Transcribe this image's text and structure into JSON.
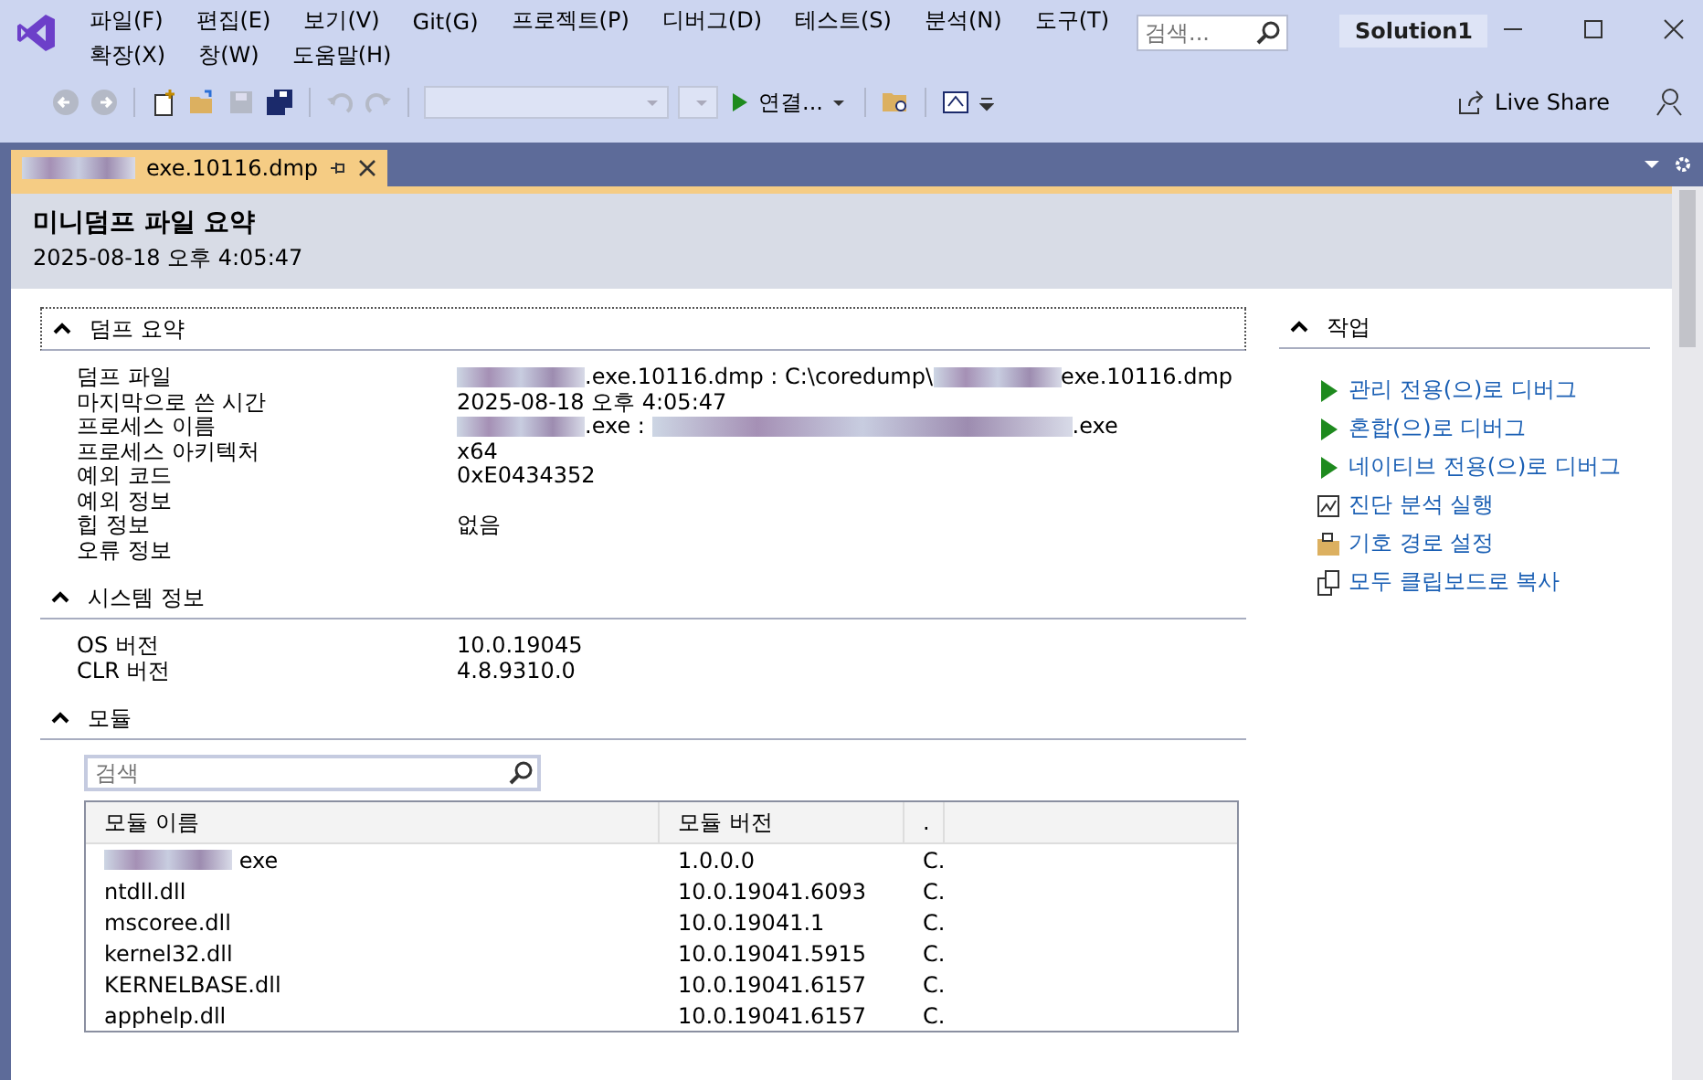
{
  "menu": {
    "rows": [
      [
        "파일(F)",
        "편집(E)",
        "보기(V)",
        "Git(G)",
        "프로젝트(P)",
        "디버그(D)",
        "테스트(S)",
        "분석(N)",
        "도구(T)"
      ],
      [
        "확장(X)",
        "창(W)",
        "도움말(H)"
      ]
    ],
    "search": {
      "placeholder": "검색..."
    },
    "solution": "Solution1"
  },
  "toolbar": {
    "attach": "연결...",
    "live_share": "Live Share"
  },
  "tab": {
    "label": "exe.10116.dmp",
    "selected": true
  },
  "header": {
    "title": "미니덤프 파일 요약",
    "time": "2025-08-18 오후 4:05:47"
  },
  "sections": [
    {
      "title": "덤프 요약",
      "expanded": true,
      "focused": true,
      "rows": [
        {
          "label": "덤프 파일",
          "value": [
            {
              "kind": "redacted"
            },
            {
              "kind": "text",
              "text": ".exe.10116.dmp : C:\\coredump\\"
            },
            {
              "kind": "redacted"
            },
            {
              "kind": "text",
              "text": "exe.10116.dmp"
            }
          ]
        },
        {
          "label": "마지막으로 쓴 시간",
          "value": [
            {
              "kind": "text",
              "text": "2025-08-18 오후 4:05:47"
            }
          ]
        },
        {
          "label": "프로세스 이름",
          "value": [
            {
              "kind": "redacted"
            },
            {
              "kind": "text",
              "text": ".exe : "
            },
            {
              "kind": "redacted_long"
            },
            {
              "kind": "text",
              "text": ".exe"
            }
          ]
        },
        {
          "label": "프로세스 아키텍처",
          "value": [
            {
              "kind": "text",
              "text": "x64"
            }
          ]
        },
        {
          "label": "예외 코드",
          "value": [
            {
              "kind": "text",
              "text": "0xE0434352"
            }
          ]
        },
        {
          "label": "예외 정보",
          "value": []
        },
        {
          "label": "힙 정보",
          "value": [
            {
              "kind": "text",
              "text": "없음"
            }
          ]
        },
        {
          "label": "오류 정보",
          "value": []
        }
      ]
    },
    {
      "title": "시스템 정보",
      "expanded": true,
      "focused": false,
      "rows": [
        {
          "label": "OS 버전",
          "value": [
            {
              "kind": "text",
              "text": "10.0.19045"
            }
          ]
        },
        {
          "label": "CLR 버전",
          "value": [
            {
              "kind": "text",
              "text": "4.8.9310.0"
            }
          ]
        }
      ]
    }
  ],
  "modules": {
    "title": "모듈",
    "expanded": true,
    "search": {
      "placeholder": "검색"
    },
    "columns": [
      "모듈 이름",
      "모듈 버전",
      "."
    ],
    "rows": [
      {
        "name": [
          {
            "kind": "redacted"
          },
          {
            "kind": "text",
            "text": " exe"
          }
        ],
        "version": "1.0.0.0",
        "column_3": "C."
      },
      {
        "name": [
          {
            "kind": "text",
            "text": "ntdll.dll"
          }
        ],
        "version": "10.0.19041.6093",
        "column_3": "C."
      },
      {
        "name": [
          {
            "kind": "text",
            "text": "mscoree.dll"
          }
        ],
        "version": "10.0.19041.1",
        "column_3": "C."
      },
      {
        "name": [
          {
            "kind": "text",
            "text": "kernel32.dll"
          }
        ],
        "version": "10.0.19041.5915",
        "column_3": "C."
      },
      {
        "name": [
          {
            "kind": "text",
            "text": "KERNELBASE.dll"
          }
        ],
        "version": "10.0.19041.6157",
        "column_3": "C."
      },
      {
        "name": [
          {
            "kind": "text",
            "text": "apphelp.dll"
          }
        ],
        "version": "10.0.19041.6157",
        "column_3": "C."
      }
    ]
  },
  "actions": {
    "title": "작업",
    "expanded": true,
    "items": [
      {
        "kind": "play",
        "label": "관리 전용(으)로 디버그"
      },
      {
        "kind": "play",
        "label": "혼합(으)로 디버그"
      },
      {
        "kind": "play",
        "label": "네이티브 전용(으)로 디버그"
      },
      {
        "kind": "diagnostics",
        "label": "진단 분석 실행"
      },
      {
        "kind": "folder",
        "label": "기호 경로 설정"
      },
      {
        "kind": "copy",
        "label": "모두 클립보드로 복사"
      }
    ]
  }
}
